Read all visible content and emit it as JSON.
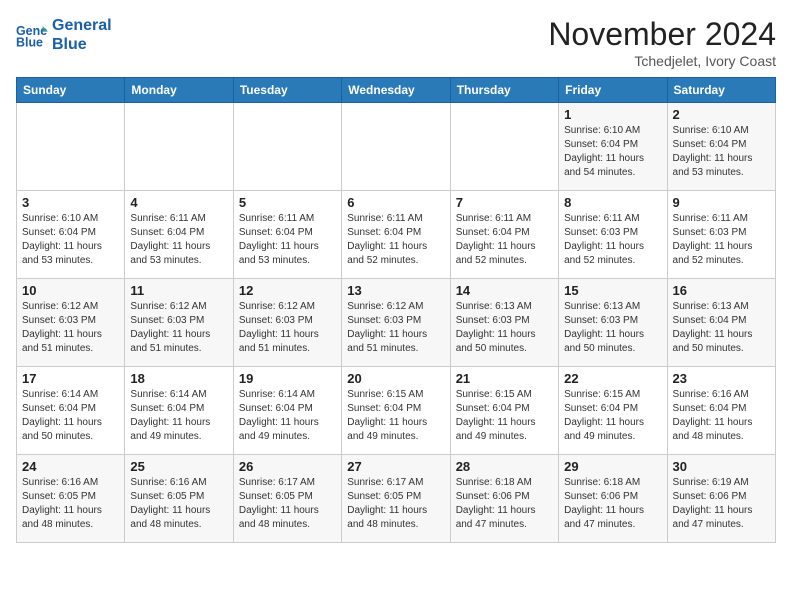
{
  "header": {
    "logo_line1": "General",
    "logo_line2": "Blue",
    "month": "November 2024",
    "location": "Tchedjelet, Ivory Coast"
  },
  "weekdays": [
    "Sunday",
    "Monday",
    "Tuesday",
    "Wednesday",
    "Thursday",
    "Friday",
    "Saturday"
  ],
  "weeks": [
    [
      {
        "day": "",
        "info": ""
      },
      {
        "day": "",
        "info": ""
      },
      {
        "day": "",
        "info": ""
      },
      {
        "day": "",
        "info": ""
      },
      {
        "day": "",
        "info": ""
      },
      {
        "day": "1",
        "info": "Sunrise: 6:10 AM\nSunset: 6:04 PM\nDaylight: 11 hours\nand 54 minutes."
      },
      {
        "day": "2",
        "info": "Sunrise: 6:10 AM\nSunset: 6:04 PM\nDaylight: 11 hours\nand 53 minutes."
      }
    ],
    [
      {
        "day": "3",
        "info": "Sunrise: 6:10 AM\nSunset: 6:04 PM\nDaylight: 11 hours\nand 53 minutes."
      },
      {
        "day": "4",
        "info": "Sunrise: 6:11 AM\nSunset: 6:04 PM\nDaylight: 11 hours\nand 53 minutes."
      },
      {
        "day": "5",
        "info": "Sunrise: 6:11 AM\nSunset: 6:04 PM\nDaylight: 11 hours\nand 53 minutes."
      },
      {
        "day": "6",
        "info": "Sunrise: 6:11 AM\nSunset: 6:04 PM\nDaylight: 11 hours\nand 52 minutes."
      },
      {
        "day": "7",
        "info": "Sunrise: 6:11 AM\nSunset: 6:04 PM\nDaylight: 11 hours\nand 52 minutes."
      },
      {
        "day": "8",
        "info": "Sunrise: 6:11 AM\nSunset: 6:03 PM\nDaylight: 11 hours\nand 52 minutes."
      },
      {
        "day": "9",
        "info": "Sunrise: 6:11 AM\nSunset: 6:03 PM\nDaylight: 11 hours\nand 52 minutes."
      }
    ],
    [
      {
        "day": "10",
        "info": "Sunrise: 6:12 AM\nSunset: 6:03 PM\nDaylight: 11 hours\nand 51 minutes."
      },
      {
        "day": "11",
        "info": "Sunrise: 6:12 AM\nSunset: 6:03 PM\nDaylight: 11 hours\nand 51 minutes."
      },
      {
        "day": "12",
        "info": "Sunrise: 6:12 AM\nSunset: 6:03 PM\nDaylight: 11 hours\nand 51 minutes."
      },
      {
        "day": "13",
        "info": "Sunrise: 6:12 AM\nSunset: 6:03 PM\nDaylight: 11 hours\nand 51 minutes."
      },
      {
        "day": "14",
        "info": "Sunrise: 6:13 AM\nSunset: 6:03 PM\nDaylight: 11 hours\nand 50 minutes."
      },
      {
        "day": "15",
        "info": "Sunrise: 6:13 AM\nSunset: 6:03 PM\nDaylight: 11 hours\nand 50 minutes."
      },
      {
        "day": "16",
        "info": "Sunrise: 6:13 AM\nSunset: 6:04 PM\nDaylight: 11 hours\nand 50 minutes."
      }
    ],
    [
      {
        "day": "17",
        "info": "Sunrise: 6:14 AM\nSunset: 6:04 PM\nDaylight: 11 hours\nand 50 minutes."
      },
      {
        "day": "18",
        "info": "Sunrise: 6:14 AM\nSunset: 6:04 PM\nDaylight: 11 hours\nand 49 minutes."
      },
      {
        "day": "19",
        "info": "Sunrise: 6:14 AM\nSunset: 6:04 PM\nDaylight: 11 hours\nand 49 minutes."
      },
      {
        "day": "20",
        "info": "Sunrise: 6:15 AM\nSunset: 6:04 PM\nDaylight: 11 hours\nand 49 minutes."
      },
      {
        "day": "21",
        "info": "Sunrise: 6:15 AM\nSunset: 6:04 PM\nDaylight: 11 hours\nand 49 minutes."
      },
      {
        "day": "22",
        "info": "Sunrise: 6:15 AM\nSunset: 6:04 PM\nDaylight: 11 hours\nand 49 minutes."
      },
      {
        "day": "23",
        "info": "Sunrise: 6:16 AM\nSunset: 6:04 PM\nDaylight: 11 hours\nand 48 minutes."
      }
    ],
    [
      {
        "day": "24",
        "info": "Sunrise: 6:16 AM\nSunset: 6:05 PM\nDaylight: 11 hours\nand 48 minutes."
      },
      {
        "day": "25",
        "info": "Sunrise: 6:16 AM\nSunset: 6:05 PM\nDaylight: 11 hours\nand 48 minutes."
      },
      {
        "day": "26",
        "info": "Sunrise: 6:17 AM\nSunset: 6:05 PM\nDaylight: 11 hours\nand 48 minutes."
      },
      {
        "day": "27",
        "info": "Sunrise: 6:17 AM\nSunset: 6:05 PM\nDaylight: 11 hours\nand 48 minutes."
      },
      {
        "day": "28",
        "info": "Sunrise: 6:18 AM\nSunset: 6:06 PM\nDaylight: 11 hours\nand 47 minutes."
      },
      {
        "day": "29",
        "info": "Sunrise: 6:18 AM\nSunset: 6:06 PM\nDaylight: 11 hours\nand 47 minutes."
      },
      {
        "day": "30",
        "info": "Sunrise: 6:19 AM\nSunset: 6:06 PM\nDaylight: 11 hours\nand 47 minutes."
      }
    ]
  ]
}
